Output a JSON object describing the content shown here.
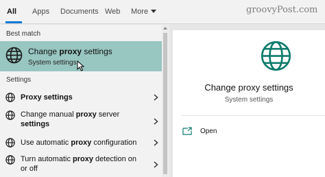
{
  "tabs": [
    {
      "label": "All",
      "active": true
    },
    {
      "label": "Apps"
    },
    {
      "label": "Documents"
    },
    {
      "label": "Web"
    },
    {
      "label": "More"
    }
  ],
  "watermark": "groovyPost.com",
  "best_match": {
    "section_label": "Best match",
    "title_prefix": "Change ",
    "title_bold": "proxy",
    "title_suffix": " settings",
    "subtitle": "System settings",
    "icon": "globe-icon"
  },
  "settings": {
    "section_label": "Settings",
    "items": [
      {
        "pre": "",
        "bold": "Proxy settings",
        "post": "",
        "line2": ""
      },
      {
        "pre": "Change manual ",
        "bold": "proxy",
        "post": " server",
        "line2": "settings",
        "line2_bold": true
      },
      {
        "pre": "Use automatic ",
        "bold": "proxy",
        "post": " configuration",
        "line2": ""
      },
      {
        "pre": "Turn automatic ",
        "bold": "proxy",
        "post": " detection on",
        "line2": "or off",
        "line2_bold": false
      }
    ]
  },
  "detail": {
    "title": "Change proxy settings",
    "subtitle": "System settings",
    "icon": "globe-icon",
    "actions": [
      {
        "label": "Open",
        "icon": "open-window-icon"
      }
    ]
  },
  "colors": {
    "accent": "#0078d4",
    "selected_bg": "#98c6c1",
    "globe_detail": "#0b7a6b"
  }
}
